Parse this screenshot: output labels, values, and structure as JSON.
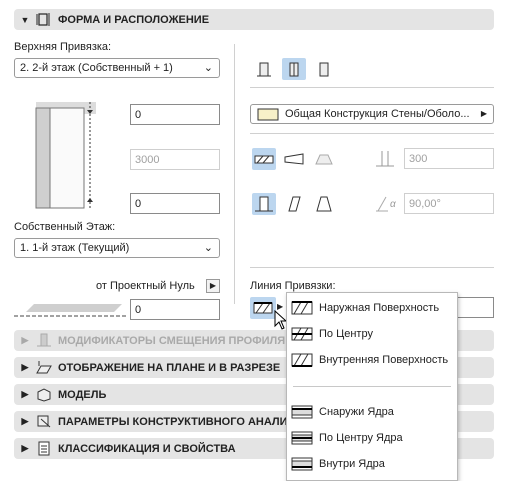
{
  "header": {
    "title": "ФОРМА И РАСПОЛОЖЕНИЕ"
  },
  "top_anchor": {
    "label": "Верхняя Привязка:",
    "value": "2. 2-й этаж (Собственный + 1)"
  },
  "offsets": {
    "top_offset": "0",
    "height": "3000",
    "bottom_offset": "0"
  },
  "home_story": {
    "label": "Собственный Этаж:",
    "value": "1. 1-й этаж (Текущий)"
  },
  "project_zero": {
    "label": "от Проектный Нуль",
    "value": "0"
  },
  "structure": {
    "value": "Общая Конструкция Стены/Оболо..."
  },
  "thickness": {
    "value": "300"
  },
  "angle": {
    "value": "90,00°",
    "symbol": "α"
  },
  "reference_line": {
    "label": "Линия Привязки:"
  },
  "reference_menu": {
    "items": [
      "Наружная Поверхность",
      "По Центру",
      "Внутренняя Поверхность",
      "Снаружи Ядра",
      "По Центру Ядра",
      "Внутри Ядра"
    ]
  },
  "sections": [
    "МОДИФИКАТОРЫ СМЕЩЕНИЯ ПРОФИЛЯ",
    "ОТОБРАЖЕНИЕ НА ПЛАНЕ И В РАЗРЕЗЕ",
    "МОДЕЛЬ",
    "ПАРАМЕТРЫ КОНСТРУКТИВНОГО АНАЛИЗА",
    "КЛАССИФИКАЦИЯ И СВОЙСТВА"
  ],
  "colors": {
    "selected_button": "#bcd6ef",
    "section_bg": "#e4e4e4"
  }
}
